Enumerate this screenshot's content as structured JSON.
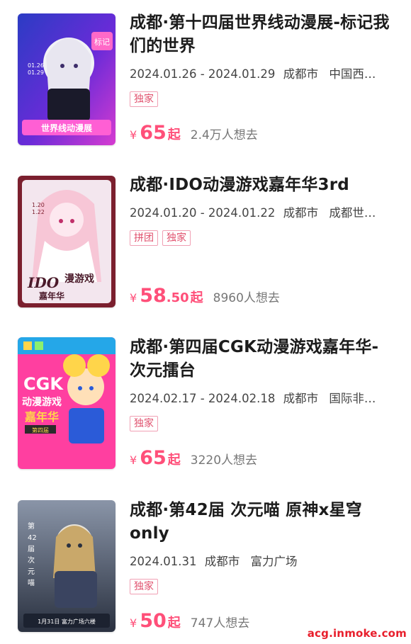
{
  "items": [
    {
      "title": "成都·第十四届世界线动漫展-标记我们的世界",
      "date_range": "2024.01.26 - 2024.01.29",
      "city": "成都市",
      "venue": "中国西…",
      "tags": [
        "独家"
      ],
      "price_main": "65",
      "price_decimal": "",
      "price_suffix": "起",
      "currency": "¥",
      "want": "2.4万人想去",
      "poster_icon": "anime-girl-poster-icon",
      "poster_colors": [
        "#2b3cc4",
        "#d63bd0",
        "#6a2bd8"
      ],
      "poster_text": [
        "标记",
        "世界线动漫展",
        "01.26",
        "01.29"
      ]
    },
    {
      "title": "成都·IDO动漫游戏嘉年华3rd",
      "date_range": "2024.01.20 - 2024.01.22",
      "city": "成都市",
      "venue": "成都世…",
      "tags": [
        "拼团",
        "独家"
      ],
      "price_main": "58",
      "price_decimal": ".50",
      "price_suffix": "起",
      "currency": "¥",
      "want": "8960人想去",
      "poster_icon": "anime-girl-poster-icon",
      "poster_colors": [
        "#7b1f2e",
        "#d9b2c2",
        "#f3e6ee"
      ],
      "poster_text": [
        "IDO",
        "漫游戏",
        "嘉年华",
        "1.20",
        "1.22"
      ]
    },
    {
      "title": "成都·第四届CGK动漫游戏嘉年华-次元擂台",
      "date_range": "2024.02.17 - 2024.02.18",
      "city": "成都市",
      "venue": "国际非…",
      "tags": [
        "独家"
      ],
      "price_main": "65",
      "price_decimal": "",
      "price_suffix": "起",
      "currency": "¥",
      "want": "3220人想去",
      "poster_icon": "anime-girl-poster-icon",
      "poster_colors": [
        "#ff3fa0",
        "#25a7e8",
        "#ffd54a"
      ],
      "poster_text": [
        "CGK",
        "动漫游戏",
        "嘉年华",
        "第四届"
      ]
    },
    {
      "title": "成都·第42届 次元喵 原神x星穹only",
      "date_range": "2024.01.31",
      "city": "成都市",
      "venue": "富力广场",
      "tags": [
        "独家"
      ],
      "price_main": "50",
      "price_decimal": "",
      "price_suffix": "起",
      "currency": "¥",
      "want": "747人想去",
      "poster_icon": "anime-girl-poster-icon",
      "poster_colors": [
        "#2a3140",
        "#8a95a8",
        "#c9a86a"
      ],
      "poster_text": [
        "第42届次元喵",
        "1月31日 富力广场六楼"
      ]
    }
  ],
  "watermark": "acg.inmoke.com",
  "accent_color": "#ff4f79"
}
